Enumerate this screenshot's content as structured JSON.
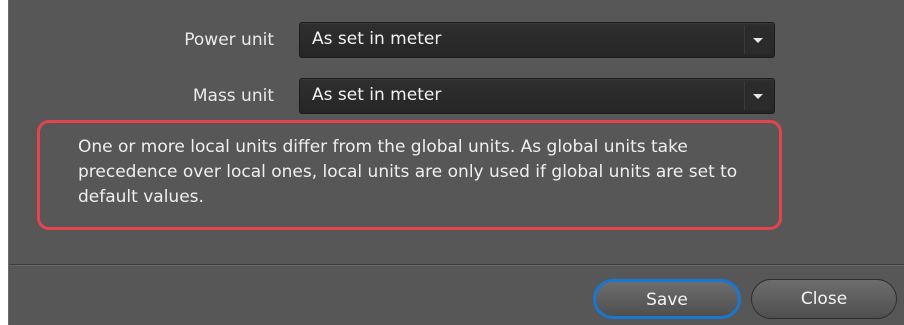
{
  "form": {
    "rows": [
      {
        "label": "Power unit",
        "value": "As set in meter"
      },
      {
        "label": "Mass unit",
        "value": "As set in meter"
      }
    ]
  },
  "notice": {
    "text": "One or more local units differ from the global units. As global units take precedence over local ones, local units are only used if global units are set to default values.",
    "border_color": "#e5444e"
  },
  "buttons": {
    "save_label": "Save",
    "close_label": "Close",
    "focus_color": "#1976d2"
  },
  "icons": {
    "dropdown": "chevron-down-icon"
  },
  "colors": {
    "dialog_bg": "#575757",
    "field_bg": "#2a2a2a",
    "text": "#eeeeee"
  }
}
